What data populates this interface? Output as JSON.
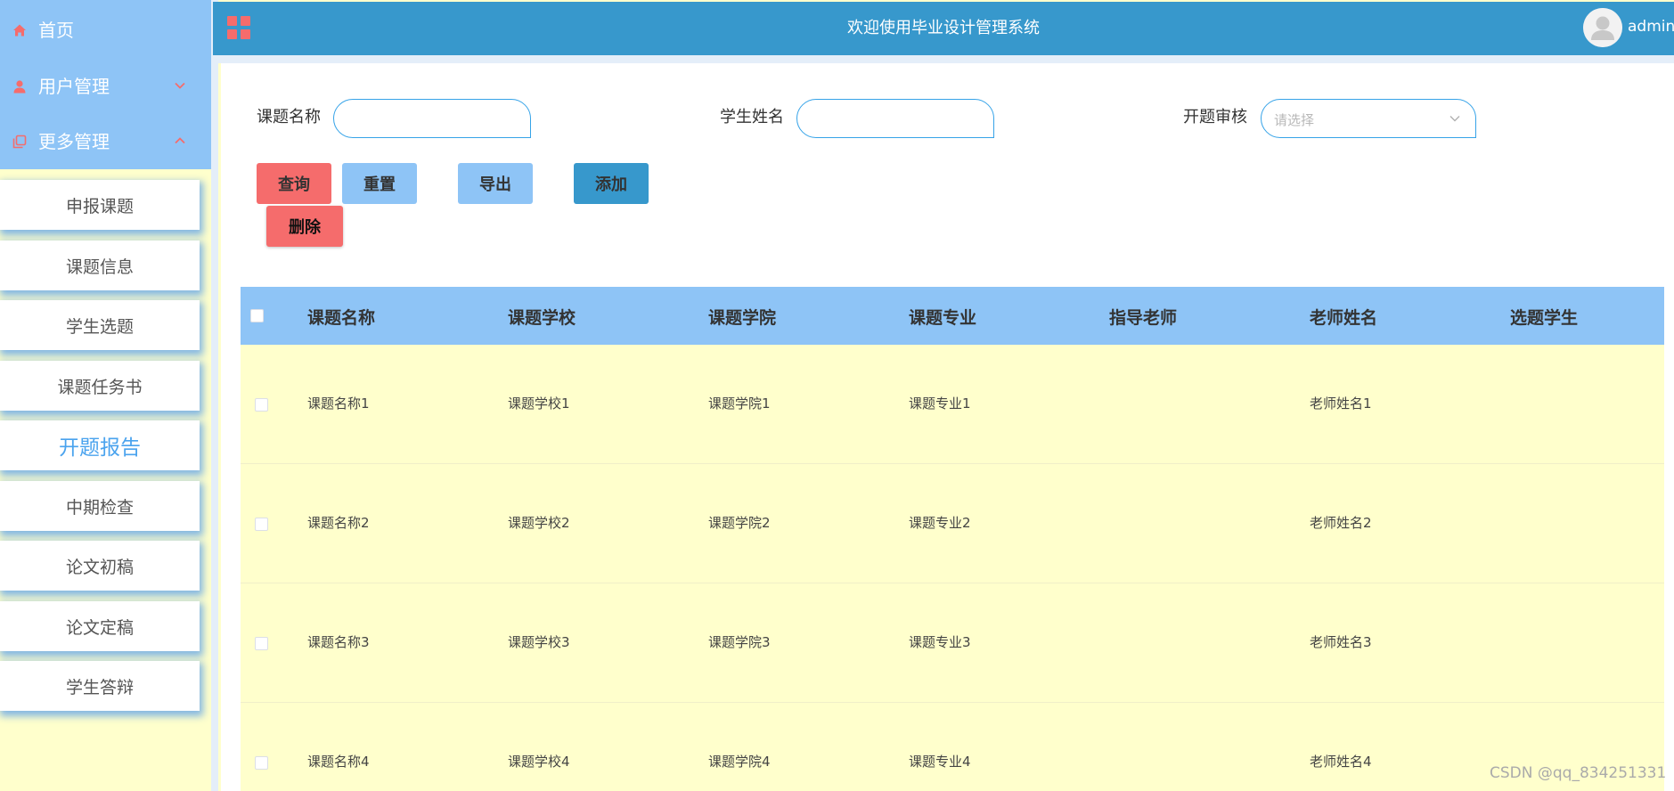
{
  "sidebar": {
    "home": {
      "label": "首页"
    },
    "user_mgmt": {
      "label": "用户管理"
    },
    "more_mgmt": {
      "label": "更多管理"
    },
    "sub_items": [
      "申报课题",
      "课题信息",
      "学生选题",
      "课题任务书",
      "开题报告",
      "中期检查",
      "论文初稿",
      "论文定稿",
      "学生答辩"
    ],
    "active_item": "开题报告"
  },
  "header": {
    "title": "欢迎使用毕业设计管理系统",
    "user": "admin"
  },
  "filters": {
    "topic_name_label": "课题名称",
    "topic_name_value": "",
    "student_name_label": "学生姓名",
    "student_name_value": "",
    "review_label": "开题审核",
    "review_placeholder": "请选择"
  },
  "buttons": {
    "query": "查询",
    "reset": "重置",
    "export": "导出",
    "add": "添加",
    "delete": "删除"
  },
  "table": {
    "columns": [
      "课题名称",
      "课题学校",
      "课题学院",
      "课题专业",
      "指导老师",
      "老师姓名",
      "选题学生"
    ],
    "rows": [
      [
        "课题名称1",
        "课题学校1",
        "课题学院1",
        "课题专业1",
        "",
        "老师姓名1",
        ""
      ],
      [
        "课题名称2",
        "课题学校2",
        "课题学院2",
        "课题专业2",
        "",
        "老师姓名2",
        ""
      ],
      [
        "课题名称3",
        "课题学校3",
        "课题学院3",
        "课题专业3",
        "",
        "老师姓名3",
        ""
      ],
      [
        "课题名称4",
        "课题学校4",
        "课题学院4",
        "课题专业4",
        "",
        "老师姓名4",
        ""
      ]
    ]
  },
  "watermark": "CSDN @qq_834251331",
  "colors": {
    "sidebar_bg": "#8ec4f6",
    "header_bg": "#3798cc",
    "row_bg": "#ffffcc",
    "danger": "#f56c6c",
    "active_text": "#4aa3ee"
  },
  "icons": {
    "home": "home-icon",
    "user": "user-icon",
    "more": "copy-icon",
    "logo": "grid-icon",
    "avatar": "avatar-icon"
  }
}
